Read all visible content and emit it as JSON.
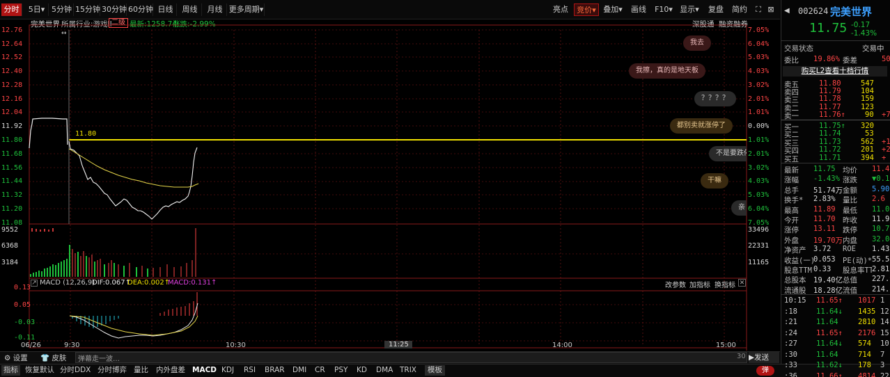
{
  "toolbar": {
    "periods": [
      "分时",
      "5日",
      "5分钟",
      "15分钟",
      "30分钟",
      "60分钟",
      "日线",
      "周线",
      "月线",
      "更多周期"
    ],
    "right": [
      "亮点",
      "竞价",
      "叠加",
      "画线",
      "F10",
      "显示",
      "复盘",
      "简约"
    ],
    "expand_icon": "expand-icon",
    "close_icon": "close-icon"
  },
  "info_bar": {
    "stock_name": "完美世界",
    "industry_label": "所属行业:游戏II",
    "level_badge": "二级",
    "latest_label": "最新:1258.74",
    "change_label": "涨跌:-2.99%",
    "right_links": [
      "深股通",
      "融资融券"
    ]
  },
  "price_axis": {
    "left": [
      "12.76",
      "12.64",
      "12.52",
      "12.40",
      "12.28",
      "12.16",
      "12.04",
      "11.92",
      "11.80",
      "11.68",
      "11.56",
      "11.44",
      "11.32",
      "11.20",
      "11.08"
    ],
    "right": [
      "7.05%",
      "6.04%",
      "5.03%",
      "4.03%",
      "3.02%",
      "2.01%",
      "1.01%",
      "0.00%",
      "1.01%",
      "2.01%",
      "3.02%",
      "4.03%",
      "5.03%",
      "6.04%",
      "7.05%"
    ],
    "ref_price_label": "11.80"
  },
  "danmaku": [
    {
      "text": "我去",
      "style": "red"
    },
    {
      "text": "我擦，真的是地天板",
      "style": "red"
    },
    {
      "text": "？？？？",
      "style": "gray"
    },
    {
      "text": "都别卖就涨停了",
      "style": "gold"
    },
    {
      "text": "不是要跌停",
      "style": "gray"
    },
    {
      "text": "干嘛",
      "style": "gold"
    },
    {
      "text": "亲",
      "style": "gray"
    }
  ],
  "volume_axis": {
    "left": [
      "9552",
      "6368",
      "3184"
    ],
    "right": [
      "33496",
      "22331",
      "11165"
    ]
  },
  "macd_bar": {
    "title": "MACD (12,26,9)",
    "dif": "DIF:0.067↑",
    "dea": "DEA:0.002↑",
    "macd": "MACD:0.131↑",
    "actions": [
      "改参数",
      "加指标",
      "换指标"
    ],
    "axis": [
      "0.13",
      "0.05",
      "-0.03",
      "-0.11"
    ]
  },
  "time_axis": [
    "06/26",
    "9:30",
    "10:30",
    "11:25",
    "14:00",
    "15:00"
  ],
  "status_bar": {
    "settings": "设置",
    "skin": "皮肤",
    "danmaku_placeholder": "弹幕走一波…",
    "count": "30",
    "send": "发送"
  },
  "bottom_tabs": [
    "指标",
    "恢复默认",
    "分时DDX",
    "分时博弈",
    "量比",
    "内外盘差",
    "MACD",
    "KDJ",
    "RSI",
    "BRAR",
    "DMI",
    "CR",
    "PSY",
    "KD",
    "DMA",
    "TRIX",
    "模板"
  ],
  "bottom_toggle": "弹",
  "quote": {
    "code": "002624",
    "name": "完美世界",
    "price": "11.75",
    "change": "-0.17",
    "change_pct": "-1.43%",
    "trade_status_label": "交易状态",
    "trade_status_value": "交易中",
    "wb_label": "委比",
    "wb_value": "19.86%",
    "wc_label": "委差",
    "wc_value": "50",
    "l2_link": "购买L2查看十档行情",
    "asks": [
      {
        "label": "卖五",
        "price": "11.80",
        "vol": "547"
      },
      {
        "label": "卖四",
        "price": "11.79",
        "vol": "104"
      },
      {
        "label": "卖三",
        "price": "11.78",
        "vol": "159"
      },
      {
        "label": "卖二",
        "price": "11.77",
        "vol": "123"
      },
      {
        "label": "卖一",
        "price": "11.76↑",
        "vol": "90",
        "extra": "+7"
      }
    ],
    "bids": [
      {
        "label": "买一",
        "price": "11.75↑",
        "vol": "320"
      },
      {
        "label": "买二",
        "price": "11.74",
        "vol": "53"
      },
      {
        "label": "买三",
        "price": "11.73",
        "vol": "562",
        "extra": "+1"
      },
      {
        "label": "买四",
        "price": "11.72",
        "vol": "201",
        "extra": "+2"
      },
      {
        "label": "买五",
        "price": "11.71",
        "vol": "394",
        "extra": "+"
      }
    ],
    "stats": [
      [
        "最新",
        "11.75",
        "均价",
        "11.4"
      ],
      [
        "涨幅",
        "-1.43%",
        "涨跌",
        "▼0.1"
      ],
      [
        "总手",
        "51.74万",
        "金额",
        "5.90"
      ],
      [
        "换手*",
        "2.83%",
        "量比",
        "2.6"
      ],
      [
        "最高",
        "11.89",
        "最低",
        "11.0"
      ],
      [
        "今开",
        "11.70",
        "昨收",
        "11.9"
      ],
      [
        "涨停",
        "13.11",
        "跌停",
        "10.7"
      ],
      [
        "外盘",
        "19.70万",
        "内盘",
        "32.04"
      ],
      [
        "净资产",
        "3.72",
        "ROE",
        "1.43"
      ],
      [
        "收益(一)",
        "0.053",
        "PE(动)*",
        "55.5"
      ],
      [
        "股息TTM",
        "0.33",
        "股息率TTM",
        "2.81"
      ],
      [
        "总股本",
        "19.40亿",
        "总值",
        "227.9"
      ],
      [
        "流通股",
        "18.28亿",
        "流值",
        "214.8"
      ]
    ],
    "ticks": [
      {
        "time": "10:15",
        "price": "11.65↑",
        "vol": "1017",
        "extra": "1"
      },
      {
        "time": ":18",
        "price": "11.64↓",
        "vol": "1435",
        "extra": "12"
      },
      {
        "time": ":21",
        "price": "11.64",
        "vol": "2810",
        "extra": "14"
      },
      {
        "time": ":24",
        "price": "11.65↑",
        "vol": "2176",
        "extra": "15"
      },
      {
        "time": ":27",
        "price": "11.64↓",
        "vol": "574",
        "extra": "10"
      },
      {
        "time": ":30",
        "price": "11.64",
        "vol": "714",
        "extra": "7"
      },
      {
        "time": ":33",
        "price": "11.62↓",
        "vol": "178",
        "extra": "3"
      },
      {
        "time": ":36",
        "price": "11.66↑",
        "vol": "4814",
        "extra": "22"
      }
    ]
  },
  "colors": {
    "up": "#ff4545",
    "down": "#1fc23c",
    "accent": "#b11414",
    "ref_line": "#f0e000"
  }
}
